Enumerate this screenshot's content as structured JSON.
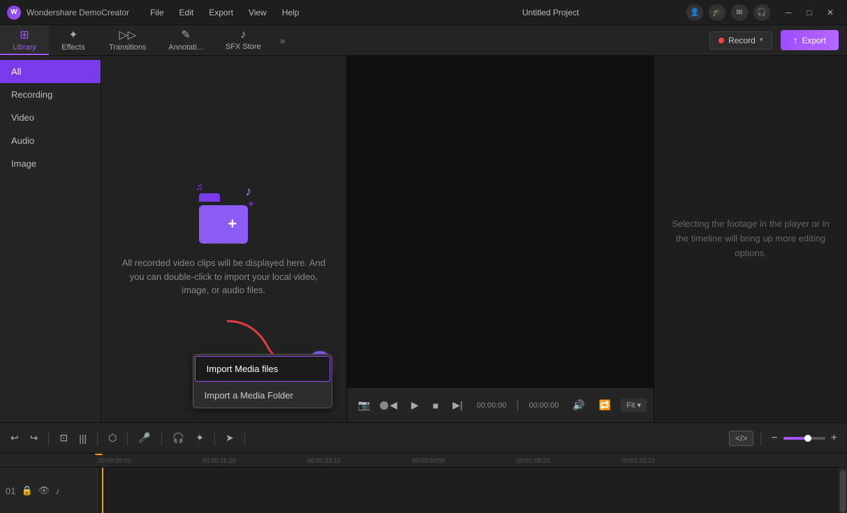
{
  "app": {
    "name": "Wondershare DemoCreator",
    "project_title": "Untitled Project"
  },
  "titlebar": {
    "menu_items": [
      "File",
      "Edit",
      "Export",
      "View",
      "Help"
    ],
    "icons": [
      "account-icon",
      "graduation-icon",
      "mail-icon",
      "headset-icon"
    ],
    "win_minimize": "─",
    "win_restore": "□",
    "win_close": "✕"
  },
  "toolbar": {
    "tabs": [
      {
        "id": "library",
        "label": "Library",
        "active": true
      },
      {
        "id": "effects",
        "label": "Effects",
        "active": false
      },
      {
        "id": "transitions",
        "label": "Transitions",
        "active": false
      },
      {
        "id": "annotations",
        "label": "Annotati...",
        "active": false
      },
      {
        "id": "sfx",
        "label": "SFX Store",
        "active": false
      }
    ],
    "more_label": "»",
    "record_label": "Record",
    "export_label": "Export"
  },
  "left_panel": {
    "categories": [
      {
        "id": "all",
        "label": "All",
        "active": true
      },
      {
        "id": "recording",
        "label": "Recording",
        "active": false
      },
      {
        "id": "video",
        "label": "Video",
        "active": false
      },
      {
        "id": "audio",
        "label": "Audio",
        "active": false
      },
      {
        "id": "image",
        "label": "Image",
        "active": false
      }
    ],
    "empty_text": "All recorded video clips will be displayed here. And you can double-click to import your local video, image, or audio files."
  },
  "import_popup": {
    "items": [
      {
        "id": "import-media",
        "label": "Import Media files",
        "highlighted": true
      },
      {
        "id": "import-folder",
        "label": "Import a Media Folder",
        "highlighted": false
      }
    ]
  },
  "player": {
    "time_current": "00:00:00",
    "time_separator": "|",
    "time_total": "00:00:00",
    "fit_label": "Fit"
  },
  "right_panel": {
    "hint_text": "Selecting the footage in the player or in the timeline will bring up more editing options."
  },
  "timeline": {
    "ruler_ticks": [
      "00:00:00:00",
      "00:00:16:20",
      "00:00:33:10",
      "00:00:50:00",
      "00:01:08:20",
      "00:01:23:10"
    ],
    "track_label": "01"
  },
  "icons": {
    "library": "⊞",
    "effects": "✦",
    "transitions": "▶▶",
    "annotations": "✎",
    "sfx": "♪",
    "record_dot": "●",
    "export_arrow": "↑",
    "undo": "↩",
    "redo": "↪",
    "crop": "⊡",
    "split": "⊗",
    "shield": "⬡",
    "mic": "🎤",
    "voice": "🎧",
    "effects_tl": "✦",
    "motion": "➤",
    "code": "</>",
    "zoom_minus": "−",
    "zoom_plus": "+",
    "play": "▶",
    "pause": "⏸",
    "stop": "■",
    "step_back": "◀",
    "step_fwd": "▶▶",
    "vol": "🔊",
    "loop": "🔁",
    "screenshot": "📷",
    "lock": "🔒",
    "eye": "👁",
    "audio_track": "♪"
  }
}
